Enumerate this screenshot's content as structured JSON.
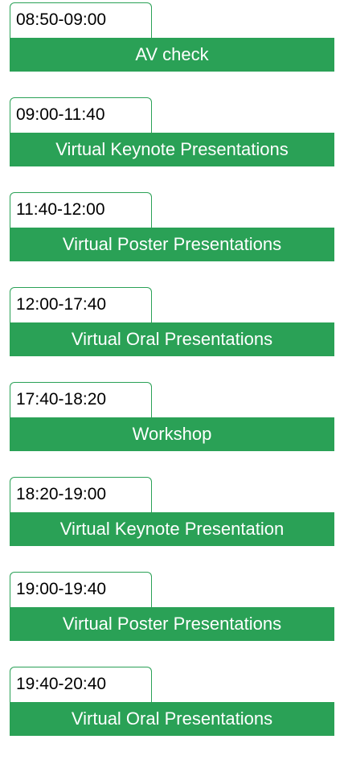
{
  "schedule": {
    "accent_color": "#2aa156",
    "slots": [
      {
        "time": "08:50-09:00",
        "session": "AV check"
      },
      {
        "time": "09:00-11:40",
        "session": "Virtual Keynote Presentations"
      },
      {
        "time": "11:40-12:00",
        "session": "Virtual Poster Presentations"
      },
      {
        "time": "12:00-17:40",
        "session": "Virtual Oral Presentations"
      },
      {
        "time": "17:40-18:20",
        "session": "Workshop"
      },
      {
        "time": "18:20-19:00",
        "session": "Virtual Keynote Presentation"
      },
      {
        "time": "19:00-19:40",
        "session": "Virtual Poster Presentations"
      },
      {
        "time": "19:40-20:40",
        "session": "Virtual Oral Presentations"
      }
    ]
  }
}
